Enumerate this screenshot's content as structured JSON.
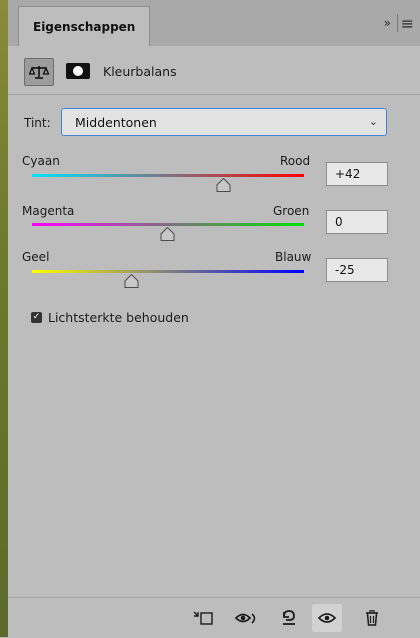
{
  "tabbar": {
    "tab_label": "Eigenschappen",
    "overflow_glyph": "»",
    "menu_glyph": "≡"
  },
  "header": {
    "title": "Kleurbalans",
    "adjustment_icon": "balance-scale-icon",
    "mask_icon": "layer-mask-icon"
  },
  "tint": {
    "label": "Tint:",
    "selected": "Middentonen"
  },
  "sliders": [
    {
      "left_label": "Cyaan",
      "right_label": "Rood",
      "value": "+42",
      "left_color": "#00e5ff",
      "right_color": "#ff0000"
    },
    {
      "left_label": "Magenta",
      "right_label": "Groen",
      "value": "0",
      "left_color": "#ff00ff",
      "right_color": "#00e000"
    },
    {
      "left_label": "Geel",
      "right_label": "Blauw",
      "value": "-25",
      "left_color": "#ffff00",
      "right_color": "#0000ff"
    }
  ],
  "preserve_luminosity": {
    "label": "Lichtsterkte behouden",
    "checked": true
  },
  "footer": {
    "icons": [
      "clip-to-layer-icon",
      "view-previous-state-icon",
      "reset-icon",
      "visibility-eye-icon",
      "trash-icon"
    ],
    "active_icon": "visibility-eye-icon"
  },
  "colors": {
    "panel_bg": "#bdbdbd",
    "accent_focus": "#3b86d4"
  }
}
